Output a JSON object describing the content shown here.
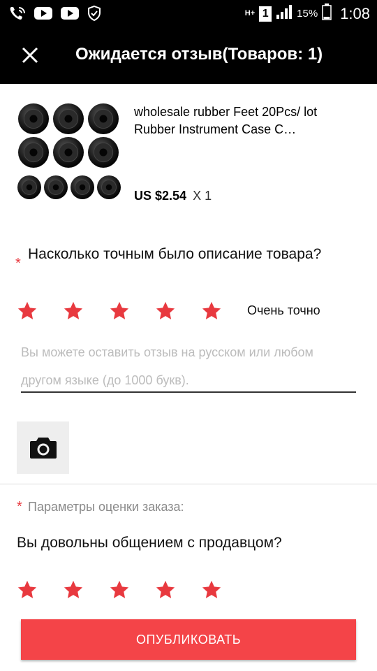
{
  "status_bar": {
    "time": "1:08",
    "battery_percent": "15%",
    "network_type": "H+",
    "sim_slot": "1",
    "icons": [
      "phone-wifi-icon",
      "youtube-icon",
      "youtube-icon",
      "shield-icon",
      "signal-icon",
      "battery-icon"
    ]
  },
  "toolbar": {
    "title": "Ожидается отзыв(Товаров: 1)",
    "close_icon": "close-icon"
  },
  "product": {
    "name": "wholesale rubber Feet  20Pcs/ lot Rubber Instrument Case C…",
    "price": "US $2.54",
    "quantity": "X 1",
    "image_icon": "rubber-feet-image"
  },
  "description_rating": {
    "asterisk": "*",
    "question": "Насколько точным было описание товара?",
    "stars": 5,
    "max_stars": 5,
    "rating_label": "Очень точно"
  },
  "review_input": {
    "placeholder": "Вы можете оставить отзыв на русском или любом другом языке (до 1000 букв)."
  },
  "photo": {
    "icon": "camera-icon"
  },
  "order_params": {
    "asterisk": "*",
    "label": "Параметры оценки заказа:",
    "question": "Вы довольны общением с продавцом?",
    "stars": 5,
    "max_stars": 5
  },
  "publish_button": {
    "label": "ОПУБЛИКОВАТЬ"
  },
  "colors": {
    "accent": "#f44448",
    "star": "#e8393f",
    "toolbar": "#000000"
  }
}
